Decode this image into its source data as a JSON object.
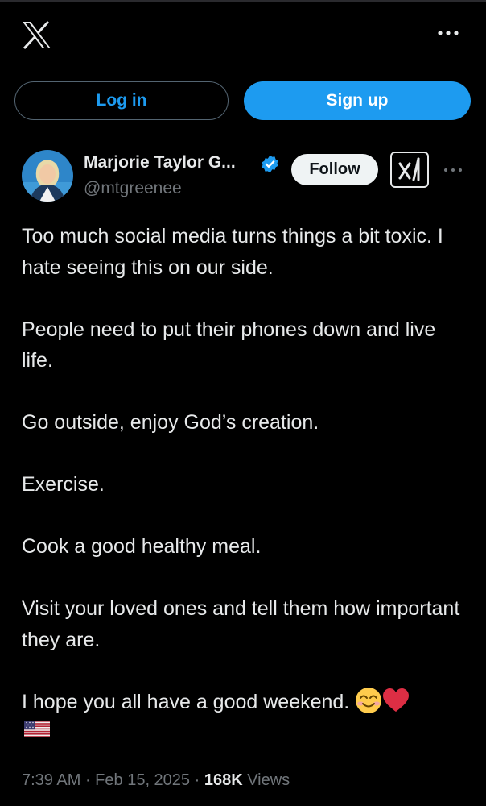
{
  "header": {
    "logo_icon": "x-logo-icon",
    "more_icon": "more-horizontal-icon"
  },
  "auth": {
    "login_label": "Log in",
    "signup_label": "Sign up"
  },
  "author": {
    "display_name": "Marjorie Taylor G...",
    "handle": "@mtgreenee",
    "verified_icon": "verified-badge-icon",
    "follow_label": "Follow",
    "grok_icon": "grok-icon",
    "more_icon": "more-horizontal-icon"
  },
  "tweet": {
    "paragraphs": [
      "Too much social media turns things a bit toxic. I hate seeing this on our side.",
      "People need to put their phones down and live life.",
      "Go outside, enjoy God’s creation.",
      "Exercise.",
      "Cook a good healthy meal.",
      "Visit your loved ones and tell them how important they are."
    ],
    "last_line": "I hope you all have a good weekend.",
    "emojis": [
      "smiling-face-emoji",
      "red-heart-emoji",
      "us-flag-emoji"
    ]
  },
  "meta": {
    "time": "7:39 AM",
    "sep1": " · ",
    "date": "Feb 15, 2025",
    "sep2": " · ",
    "views_count": "168K",
    "views_label": " Views"
  },
  "colors": {
    "background": "#000000",
    "accent": "#1d9bf0",
    "text": "#e7e9ea",
    "secondary": "#71767b"
  }
}
